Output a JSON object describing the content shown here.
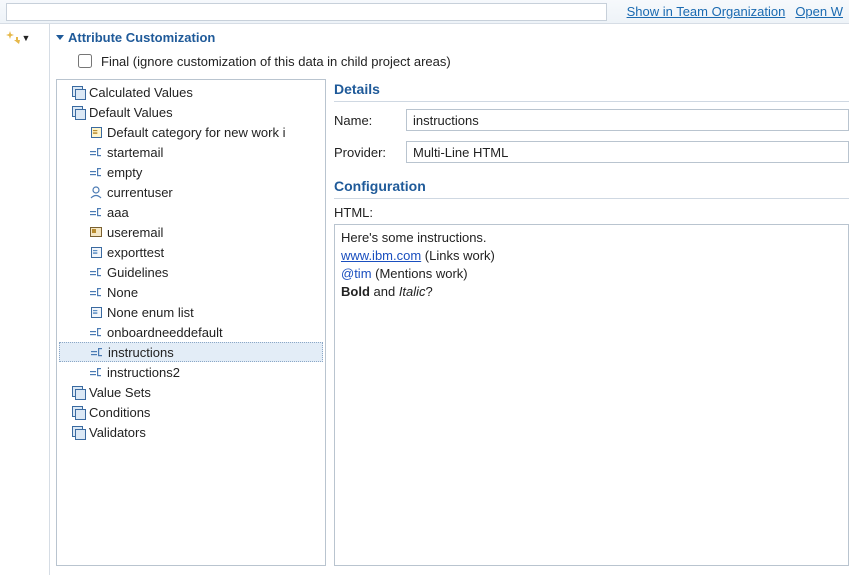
{
  "topLinks": {
    "org": "Show in Team Organization",
    "openw": "Open W"
  },
  "section": {
    "title": "Attribute Customization",
    "final": "Final (ignore customization of this data in child project areas)"
  },
  "tree": {
    "calcValues": "Calculated Values",
    "defaultValues": "Default Values",
    "items": {
      "defaultCat": "Default category for new work i",
      "startemail": "startemail",
      "empty": "empty",
      "currentuser": "currentuser",
      "aaa": "aaa",
      "useremail": "useremail",
      "exporttest": "exporttest",
      "guidelines": "Guidelines",
      "none": "None",
      "noneEnum": "None enum list",
      "onboard": "onboardneeddefault",
      "instructions": "instructions",
      "instructions2": "instructions2"
    },
    "valueSets": "Value Sets",
    "conditions": "Conditions",
    "validators": "Validators"
  },
  "details": {
    "title": "Details",
    "nameLabel": "Name:",
    "nameValue": "instructions",
    "providerLabel": "Provider:",
    "providerValue": "Multi-Line HTML"
  },
  "config": {
    "title": "Configuration",
    "htmlLabel": "HTML:",
    "line1": "Here's some instructions.",
    "link": "www.ibm.com",
    "linkTail": "   (Links work)",
    "mention": "@tim",
    "mentionTail": " (Mentions work)",
    "bold": "Bold",
    "and": " and ",
    "italic": "Italic",
    "q": "?"
  }
}
